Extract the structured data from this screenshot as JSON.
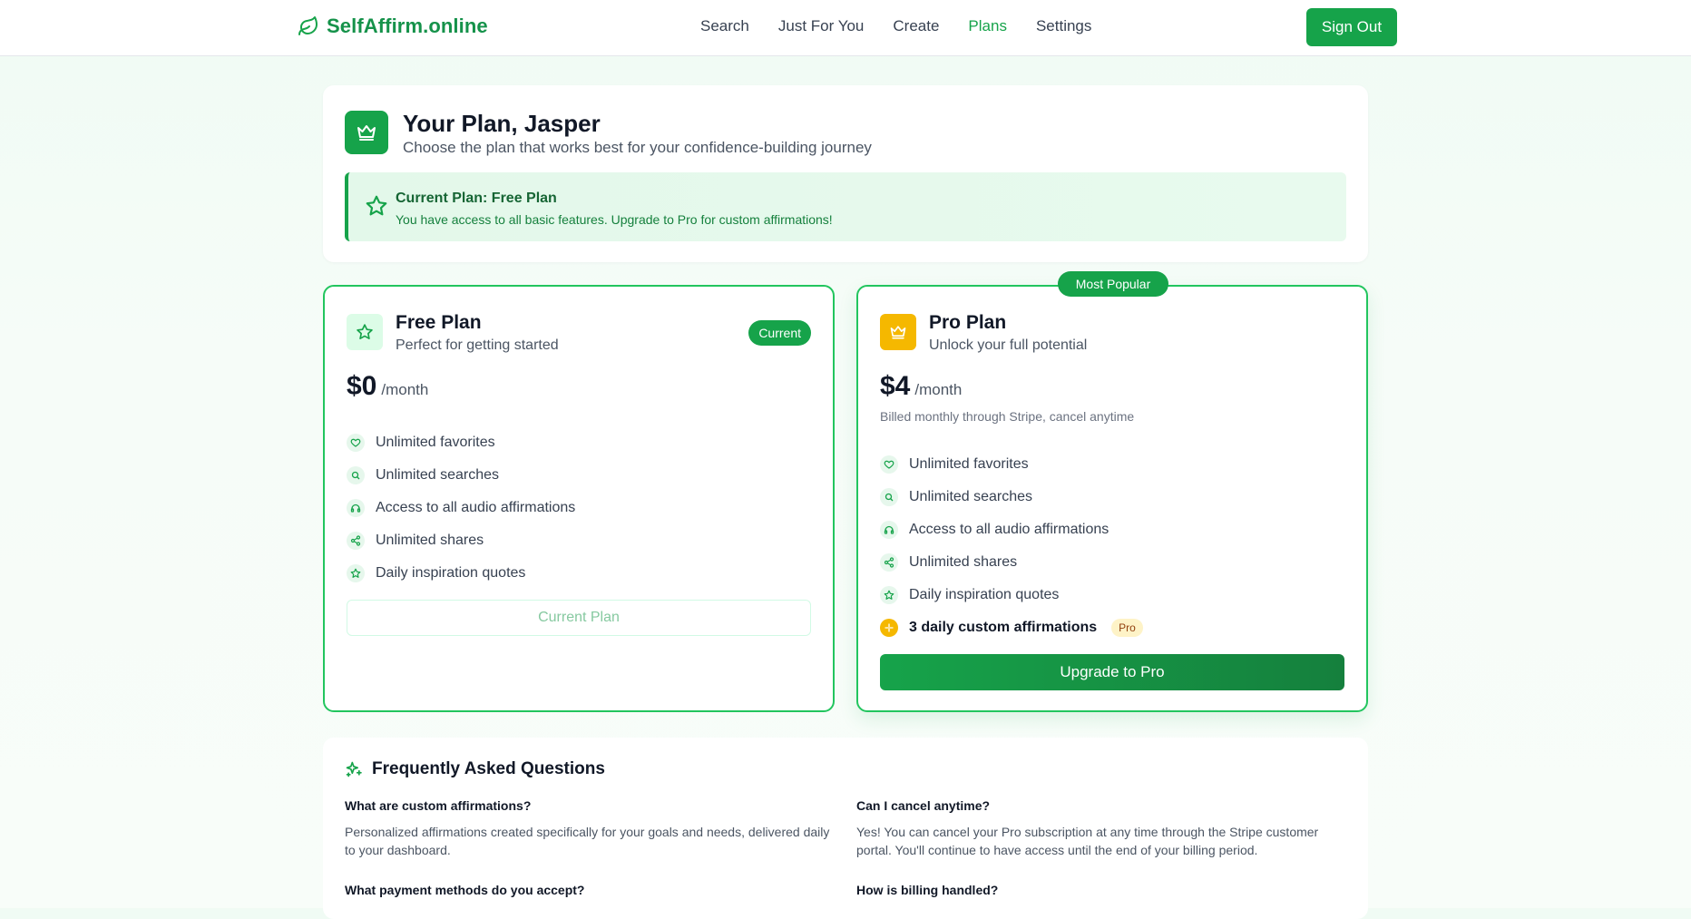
{
  "brand": {
    "name": "SelfAffirm.online",
    "icon": "leaf-icon"
  },
  "nav": {
    "items": [
      {
        "label": "Search",
        "active": false
      },
      {
        "label": "Just For You",
        "active": false
      },
      {
        "label": "Create",
        "active": false
      },
      {
        "label": "Plans",
        "active": true
      },
      {
        "label": "Settings",
        "active": false
      }
    ],
    "sign_out": "Sign Out"
  },
  "hero": {
    "title": "Your Plan, Jasper",
    "subtitle": "Choose the plan that works best for your confidence-building journey",
    "notice_title": "Current Plan: Free Plan",
    "notice_text": "You have access to all basic features. Upgrade to Pro for custom affirmations!"
  },
  "plans": {
    "free": {
      "name": "Free Plan",
      "tagline": "Perfect for getting started",
      "badge": "Current",
      "price": "$0",
      "period": "/month",
      "features": [
        {
          "icon": "heart-icon",
          "text": "Unlimited favorites"
        },
        {
          "icon": "search-icon",
          "text": "Unlimited searches"
        },
        {
          "icon": "headphones-icon",
          "text": "Access to all audio affirmations"
        },
        {
          "icon": "share-icon",
          "text": "Unlimited shares"
        },
        {
          "icon": "star-icon",
          "text": "Daily inspiration quotes"
        }
      ],
      "button": "Current Plan"
    },
    "pro": {
      "name": "Pro Plan",
      "tagline": "Unlock your full potential",
      "badge": "Most Popular",
      "price": "$4",
      "period": "/month",
      "billing_note": "Billed monthly through Stripe, cancel anytime",
      "features": [
        {
          "icon": "heart-icon",
          "text": "Unlimited favorites"
        },
        {
          "icon": "search-icon",
          "text": "Unlimited searches"
        },
        {
          "icon": "headphones-icon",
          "text": "Access to all audio affirmations"
        },
        {
          "icon": "share-icon",
          "text": "Unlimited shares"
        },
        {
          "icon": "star-icon",
          "text": "Daily inspiration quotes"
        },
        {
          "icon": "sparkle-icon",
          "text": "3 daily custom affirmations",
          "chip": "Pro"
        }
      ],
      "button": "Upgrade to Pro"
    }
  },
  "faq": {
    "title": "Frequently Asked Questions",
    "items": [
      {
        "q": "What are custom affirmations?",
        "a": "Personalized affirmations created specifically for your goals and needs, delivered daily to your dashboard."
      },
      {
        "q": "Can I cancel anytime?",
        "a": "Yes! You can cancel your Pro subscription at any time through the Stripe customer portal. You'll continue to have access until the end of your billing period."
      },
      {
        "q": "What payment methods do you accept?",
        "a": ""
      },
      {
        "q": "How is billing handled?",
        "a": ""
      }
    ]
  },
  "colors": {
    "accent": "#16a34a",
    "gold": "#f5b800"
  }
}
